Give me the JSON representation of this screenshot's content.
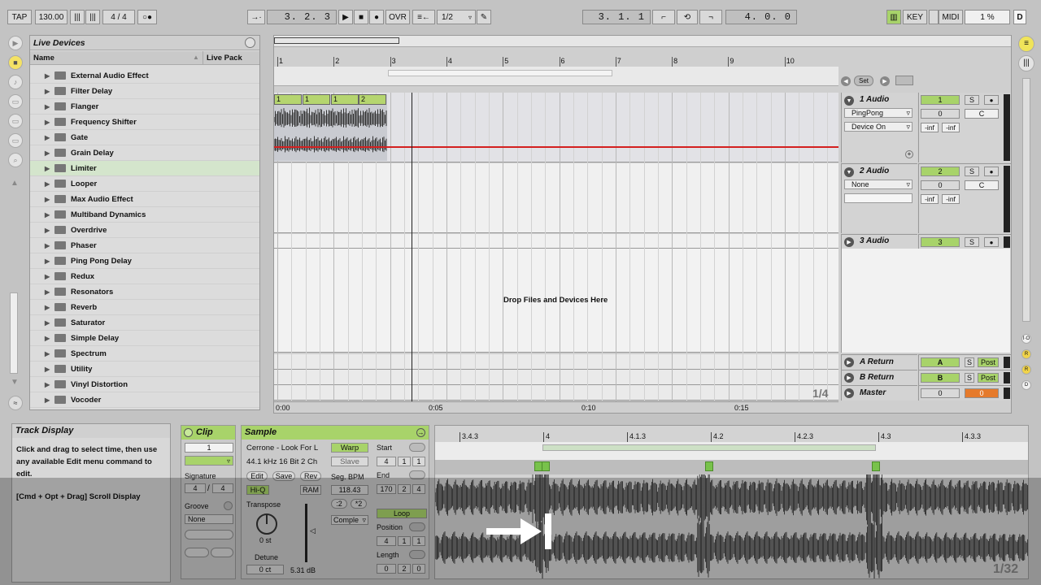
{
  "transport": {
    "tap": "TAP",
    "tempo": "130.00",
    "time_sig_num": "4",
    "time_sig_den": "4",
    "arrangement_pos": "3.   2.   3",
    "ovr": "OVR",
    "quantize": "1/2",
    "loop_start": "3.   1.   1",
    "loop_length": "4.   0.   0",
    "key": "KEY",
    "midi": "MIDI",
    "cpu": "1 %",
    "d": "D"
  },
  "browser": {
    "title": "Live Devices",
    "col_name": "Name",
    "col_pack": "Live Pack",
    "items": [
      "External Audio Effect",
      "Filter Delay",
      "Flanger",
      "Frequency Shifter",
      "Gate",
      "Grain Delay",
      "Limiter",
      "Looper",
      "Max Audio Effect",
      "Multiband Dynamics",
      "Overdrive",
      "Phaser",
      "Ping Pong Delay",
      "Redux",
      "Resonators",
      "Reverb",
      "Saturator",
      "Simple Delay",
      "Spectrum",
      "Utility",
      "Vinyl Distortion",
      "Vocoder"
    ],
    "selected_index": 6
  },
  "arrangement": {
    "bars": [
      "1",
      "2",
      "3",
      "4",
      "5",
      "6",
      "7",
      "8",
      "9",
      "10"
    ],
    "set_label": "Set",
    "clip_labels": [
      "1",
      "1",
      "1",
      "2"
    ],
    "drop_text": "Drop Files and Devices Here",
    "zoom": "1/4",
    "times": [
      "0:00",
      "0:05",
      "0:10",
      "0:15"
    ],
    "tracks": [
      {
        "name": "1 Audio",
        "num": "1",
        "device": "PingPong",
        "chooser": "Device On",
        "vol": "0",
        "pan": "C",
        "inf1": "-inf",
        "inf2": "-inf"
      },
      {
        "name": "2 Audio",
        "num": "2",
        "device": "None",
        "vol": "0",
        "pan": "C",
        "inf1": "-inf",
        "inf2": "-inf"
      },
      {
        "name": "3 Audio",
        "num": "3"
      }
    ],
    "returns": [
      {
        "name": "A Return",
        "letter": "A",
        "post": "Post"
      },
      {
        "name": "B Return",
        "letter": "B",
        "post": "Post"
      }
    ],
    "master": {
      "name": "Master",
      "vol": "0",
      "pan": "0"
    },
    "solo": "S"
  },
  "info": {
    "title": "Track Display",
    "body": "Click and drag to select time, then use any available Edit menu command to edit.",
    "hint": "[Cmd + Opt + Drag] Scroll Display"
  },
  "clip_panel": {
    "title": "Clip",
    "value": "1",
    "signature_label": "Signature",
    "sig_num": "4",
    "sig_den": "4",
    "groove_label": "Groove",
    "groove_value": "None"
  },
  "sample_panel": {
    "title": "Sample",
    "file": "Cerrone - Look For L",
    "format": "44.1 kHz 16 Bit 2 Ch",
    "warp": "Warp",
    "slave": "Slave",
    "edit": "Edit",
    "save": "Save",
    "rev": "Rev",
    "hiq": "Hi-Q",
    "ram": "RAM",
    "seg_bpm_label": "Seg. BPM",
    "seg_bpm": "118.43",
    "half": ":2",
    "double": "*2",
    "mode": "Comple",
    "transpose_label": "Transpose",
    "transpose_value": "0 st",
    "detune_label": "Detune",
    "detune_value": "0 ct",
    "gain": "5.31 dB",
    "start_label": "Start",
    "start": [
      "4",
      "1",
      "1"
    ],
    "end_label": "End",
    "end": [
      "170",
      "2",
      "4"
    ],
    "loop": "Loop",
    "position_label": "Position",
    "position": [
      "4",
      "1",
      "1"
    ],
    "length_label": "Length",
    "length": [
      "0",
      "2",
      "0"
    ]
  },
  "waveform": {
    "ruler": [
      "3.4.3",
      "4",
      "4.1.3",
      "4.2",
      "4.2.3",
      "4.3",
      "4.3.3"
    ],
    "zoom": "1/32"
  }
}
